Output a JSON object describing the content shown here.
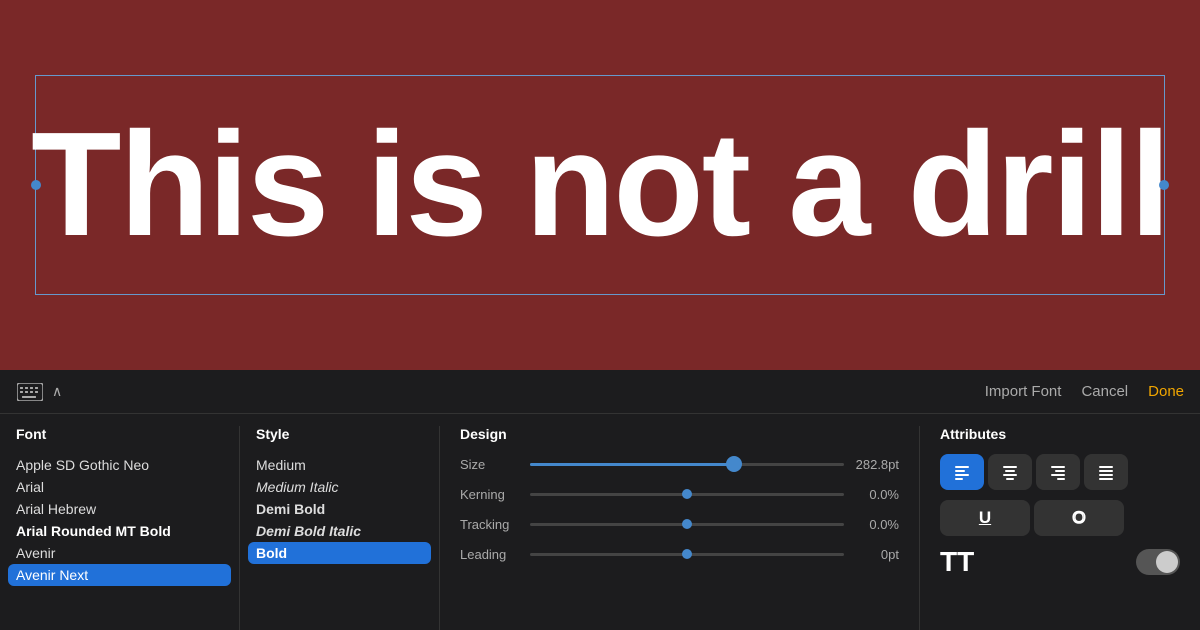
{
  "canvas": {
    "headline": "This is not a drill"
  },
  "toolbar": {
    "import_font_label": "Import Font",
    "cancel_label": "Cancel",
    "done_label": "Done"
  },
  "font_column": {
    "header": "Font",
    "items": [
      {
        "label": "Apple SD Gothic Neo",
        "style": "normal",
        "selected": false
      },
      {
        "label": "Arial",
        "style": "normal",
        "selected": false
      },
      {
        "label": "Arial Hebrew",
        "style": "normal",
        "selected": false
      },
      {
        "label": "Arial Rounded MT Bold",
        "style": "bold",
        "selected": false
      },
      {
        "label": "Avenir",
        "style": "normal",
        "selected": false
      },
      {
        "label": "Avenir Next",
        "style": "normal",
        "selected": true
      }
    ]
  },
  "style_column": {
    "header": "Style",
    "items": [
      {
        "label": "Medium",
        "style": "normal",
        "selected": false
      },
      {
        "label": "Medium Italic",
        "style": "italic",
        "selected": false
      },
      {
        "label": "Demi Bold",
        "style": "semi-bold",
        "selected": false
      },
      {
        "label": "Demi Bold Italic",
        "style": "demi-bold-italic",
        "selected": false
      },
      {
        "label": "Bold",
        "style": "bold",
        "selected": true
      }
    ]
  },
  "design_column": {
    "header": "Design",
    "rows": [
      {
        "label": "Size",
        "value": "282.8pt",
        "slider_type": "fill",
        "fill_pct": 65
      },
      {
        "label": "Kerning",
        "value": "0.0%",
        "slider_type": "dot"
      },
      {
        "label": "Tracking",
        "value": "0.0%",
        "slider_type": "dot"
      },
      {
        "label": "Leading",
        "value": "0pt",
        "slider_type": "dot"
      }
    ]
  },
  "attributes_column": {
    "header": "Attributes",
    "align_buttons": [
      {
        "label": "align-left",
        "active": true
      },
      {
        "label": "align-center",
        "active": false
      },
      {
        "label": "align-right",
        "active": false
      },
      {
        "label": "justify",
        "active": false
      }
    ],
    "format_buttons": [
      {
        "label": "U",
        "type": "underline"
      },
      {
        "label": "O",
        "type": "outline"
      }
    ],
    "tt_label": "TT",
    "toggle_on": false
  }
}
